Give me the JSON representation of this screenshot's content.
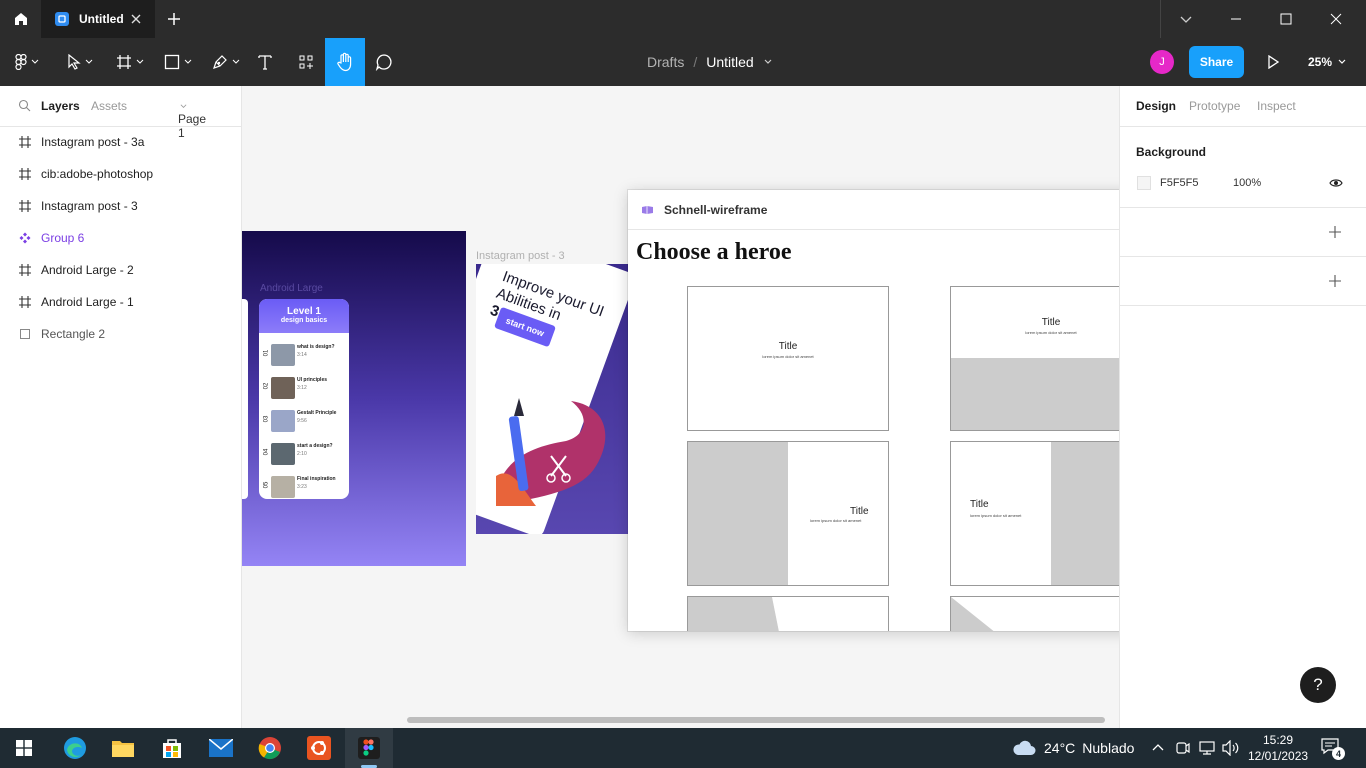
{
  "window": {
    "tab_title": "Untitled"
  },
  "toolbar": {
    "breadcrumb_parent": "Drafts",
    "breadcrumb_separator": "/",
    "file_title": "Untitled",
    "avatar_initial": "J",
    "share_label": "Share",
    "zoom_label": "25%",
    "accent_color": "#18a0fb"
  },
  "left_panel": {
    "tabs": [
      "Layers",
      "Assets"
    ],
    "page_selector": "Page 1",
    "layers": [
      {
        "name": "Instagram post - 3a",
        "icon": "frame-icon"
      },
      {
        "name": "cib:adobe-photoshop",
        "icon": "frame-icon"
      },
      {
        "name": "Instagram post - 3",
        "icon": "frame-icon"
      },
      {
        "name": "Group 6",
        "icon": "component-icon"
      },
      {
        "name": "Android Large - 2",
        "icon": "frame-icon"
      },
      {
        "name": "Android Large - 1",
        "icon": "frame-icon"
      },
      {
        "name": "Rectangle 2",
        "icon": "rectangle-icon"
      }
    ]
  },
  "canvas": {
    "frame_label": "Instagram post - 3",
    "phone_label": "Android Large",
    "phone_header": "Level 1",
    "phone_subheader": "design basics",
    "phone_items": [
      {
        "num": "01",
        "title": "what is design?",
        "time": "3:14"
      },
      {
        "num": "02",
        "title": "UI principles",
        "time": "3:12"
      },
      {
        "num": "03",
        "title": "Gestalt Principle",
        "time": "9:56"
      },
      {
        "num": "04",
        "title": "start a design?",
        "time": "2:10"
      },
      {
        "num": "05",
        "title": "Final inspiration",
        "time": "3:23"
      }
    ],
    "card_line1": "Improve your UI",
    "card_line2": "Abilities in",
    "card_line3": "3 Months",
    "card_button": "start now"
  },
  "plugin": {
    "title": "Schnell-wireframe",
    "heading": "Choose a heroe",
    "heroes": [
      {
        "title": "Title",
        "subtitle": "lorem ipsum dolor sit amenet"
      },
      {
        "title": "Title",
        "subtitle": "lorem ipsum dolor sit amenet"
      },
      {
        "title": "Title",
        "subtitle": "lorem ipsum dolor sit amenet"
      },
      {
        "title": "Title",
        "subtitle": "lorem ipsum dolor sit amenet"
      }
    ]
  },
  "right_panel": {
    "tabs": [
      "Design",
      "Prototype",
      "Inspect"
    ],
    "background_label": "Background",
    "background_hex": "F5F5F5",
    "background_opacity": "100%",
    "help_label": "?"
  },
  "taskbar": {
    "weather_temp": "24°C",
    "weather_desc": "Nublado",
    "time": "15:29",
    "date": "12/01/2023",
    "notification_count": "4"
  }
}
